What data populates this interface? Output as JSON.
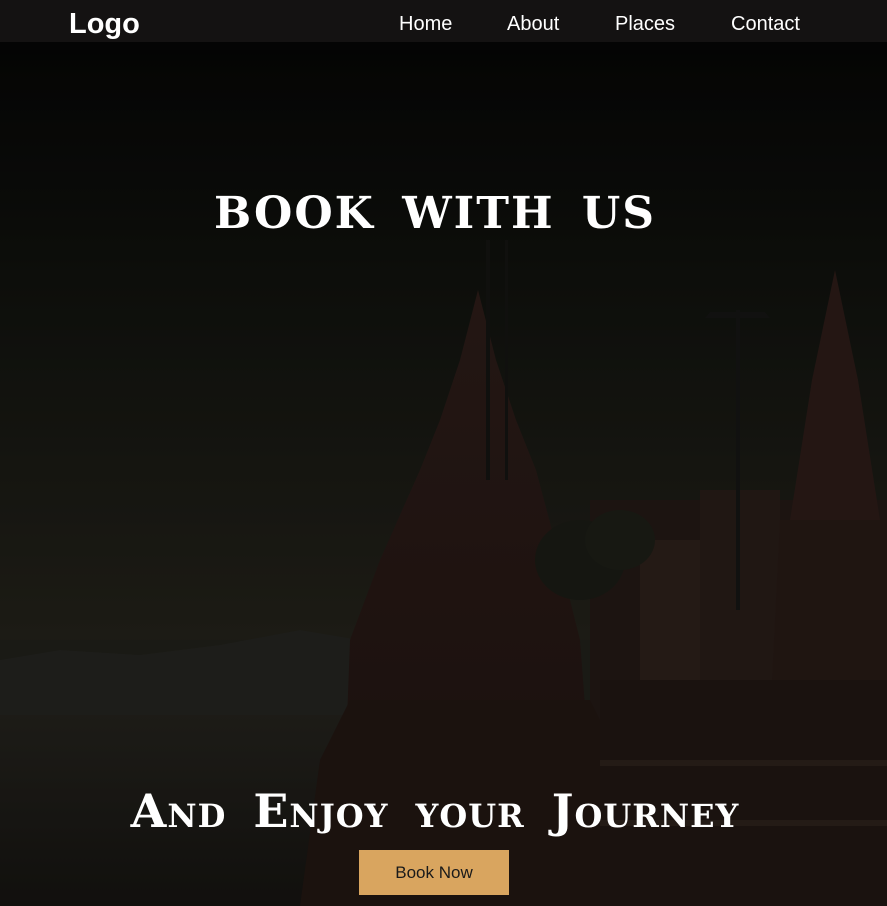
{
  "navbar": {
    "logo": "Logo",
    "links": [
      "Home",
      "About",
      "Places",
      "Contact"
    ]
  },
  "hero": {
    "headline": "BOOK WITH US",
    "subheadline": "And Enjoy your Journey",
    "button_label": "Book Now",
    "background_image": "temple-riverside-scene"
  },
  "colors": {
    "navbar_bg": "#141212",
    "button_bg": "#d9a55f",
    "text": "#ffffff"
  }
}
